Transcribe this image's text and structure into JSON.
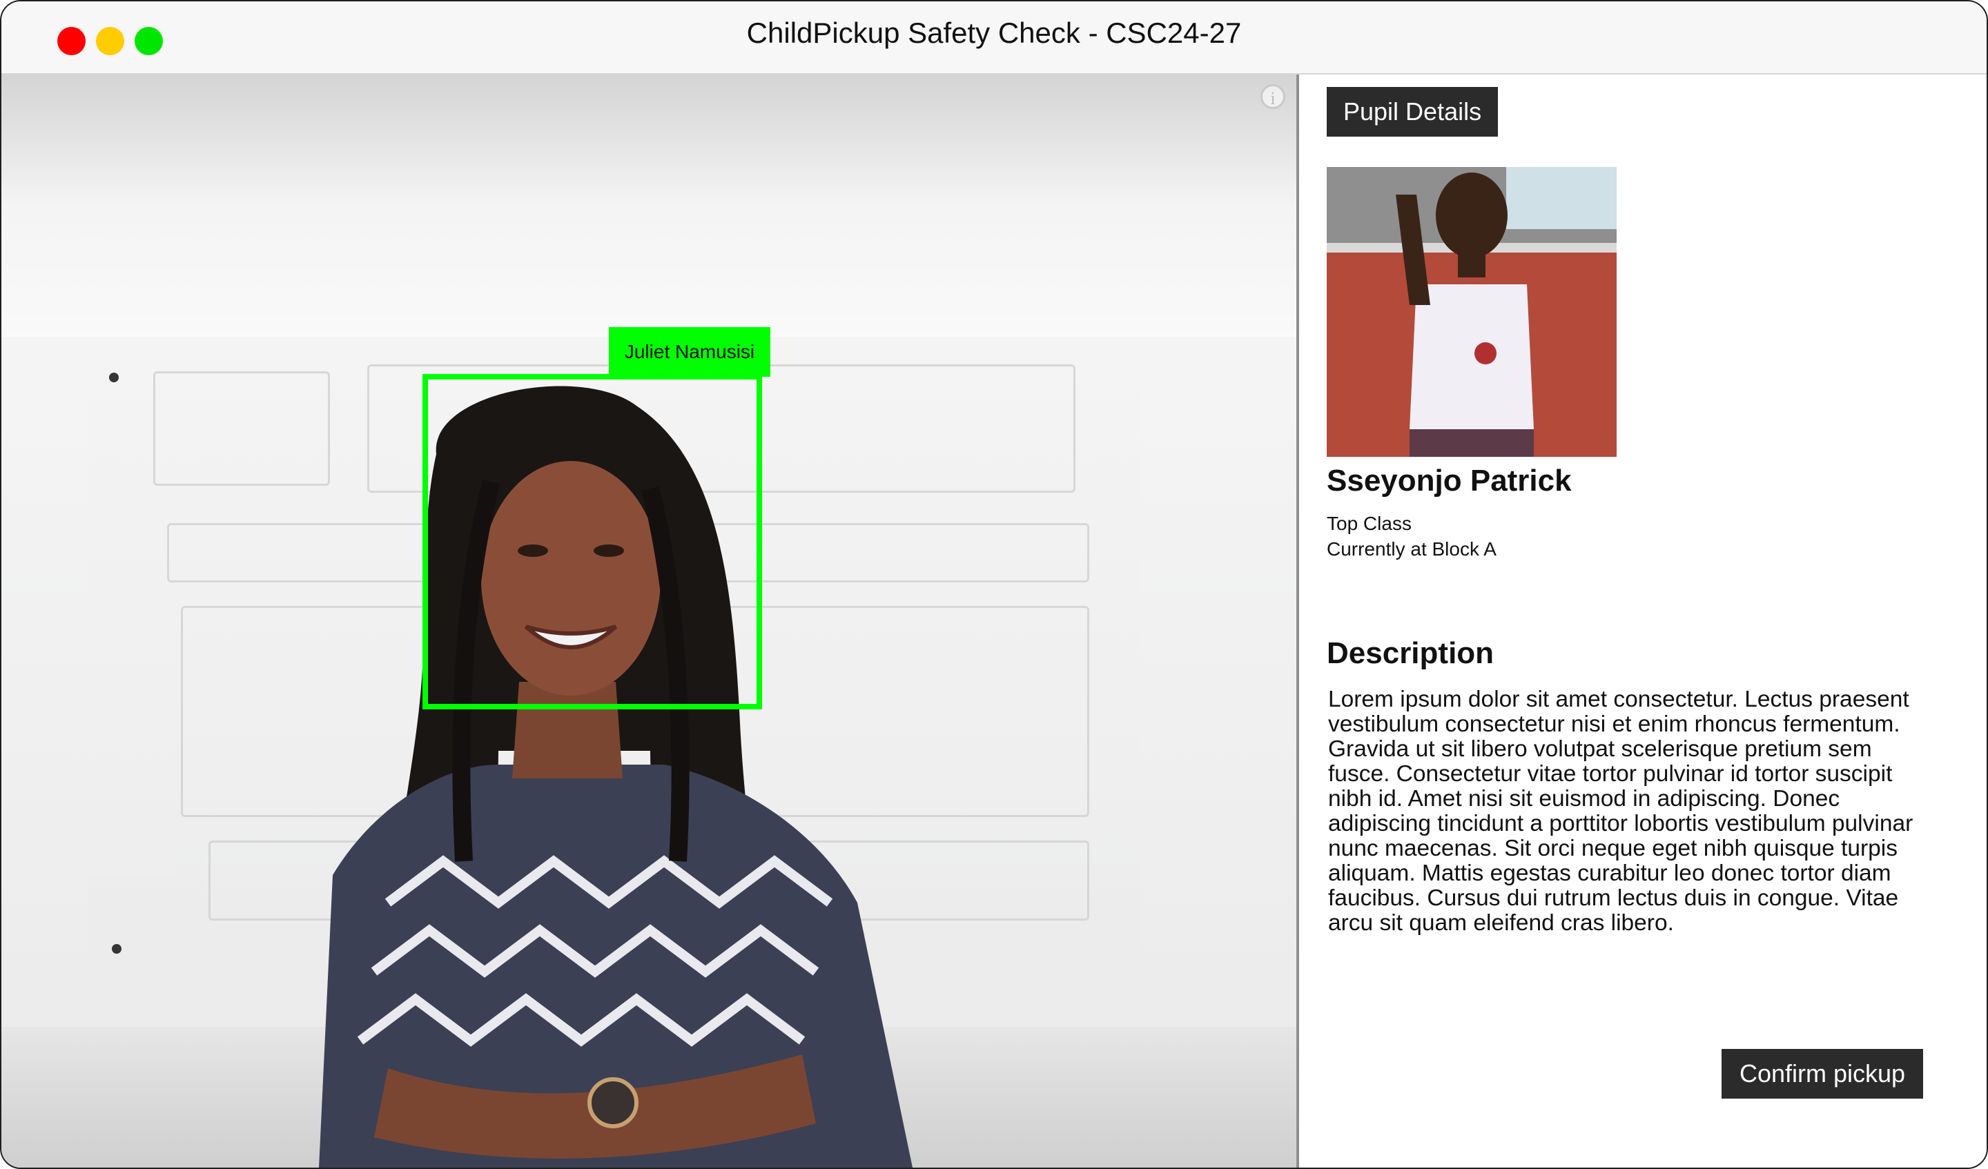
{
  "window": {
    "title": "ChildPickup Safety Check - CSC24-27",
    "controls": {
      "close_color": "#ff0000",
      "minimize_color": "#ffcc00",
      "maximize_color": "#00e600"
    }
  },
  "camera": {
    "info_icon_glyph": "i",
    "detection": {
      "label": "Juliet Namusisi",
      "box_color": "#00ff00"
    }
  },
  "panel": {
    "header_chip": "Pupil Details",
    "pupil": {
      "name": "Sseyonjo Patrick",
      "class": "Top Class",
      "location": "Currently at Block A"
    },
    "description_title": "Description",
    "description": "Lorem ipsum dolor sit amet consectetur. Lectus praesent vestibulum consectetur nisi et enim rhoncus fermentum. Gravida ut sit libero volutpat scelerisque pretium sem fusce. Consectetur vitae tortor pulvinar id tortor suscipit nibh id. Amet nisi sit euismod in adipiscing. Donec adipiscing tincidunt a porttitor lobortis vestibulum pulvinar nunc maecenas. Sit orci neque eget nibh quisque turpis aliquam. Mattis egestas curabitur leo donec tortor diam faucibus. Cursus dui rutrum lectus duis in congue. Vitae arcu sit quam eleifend cras libero.",
    "confirm_button": "Confirm pickup"
  }
}
